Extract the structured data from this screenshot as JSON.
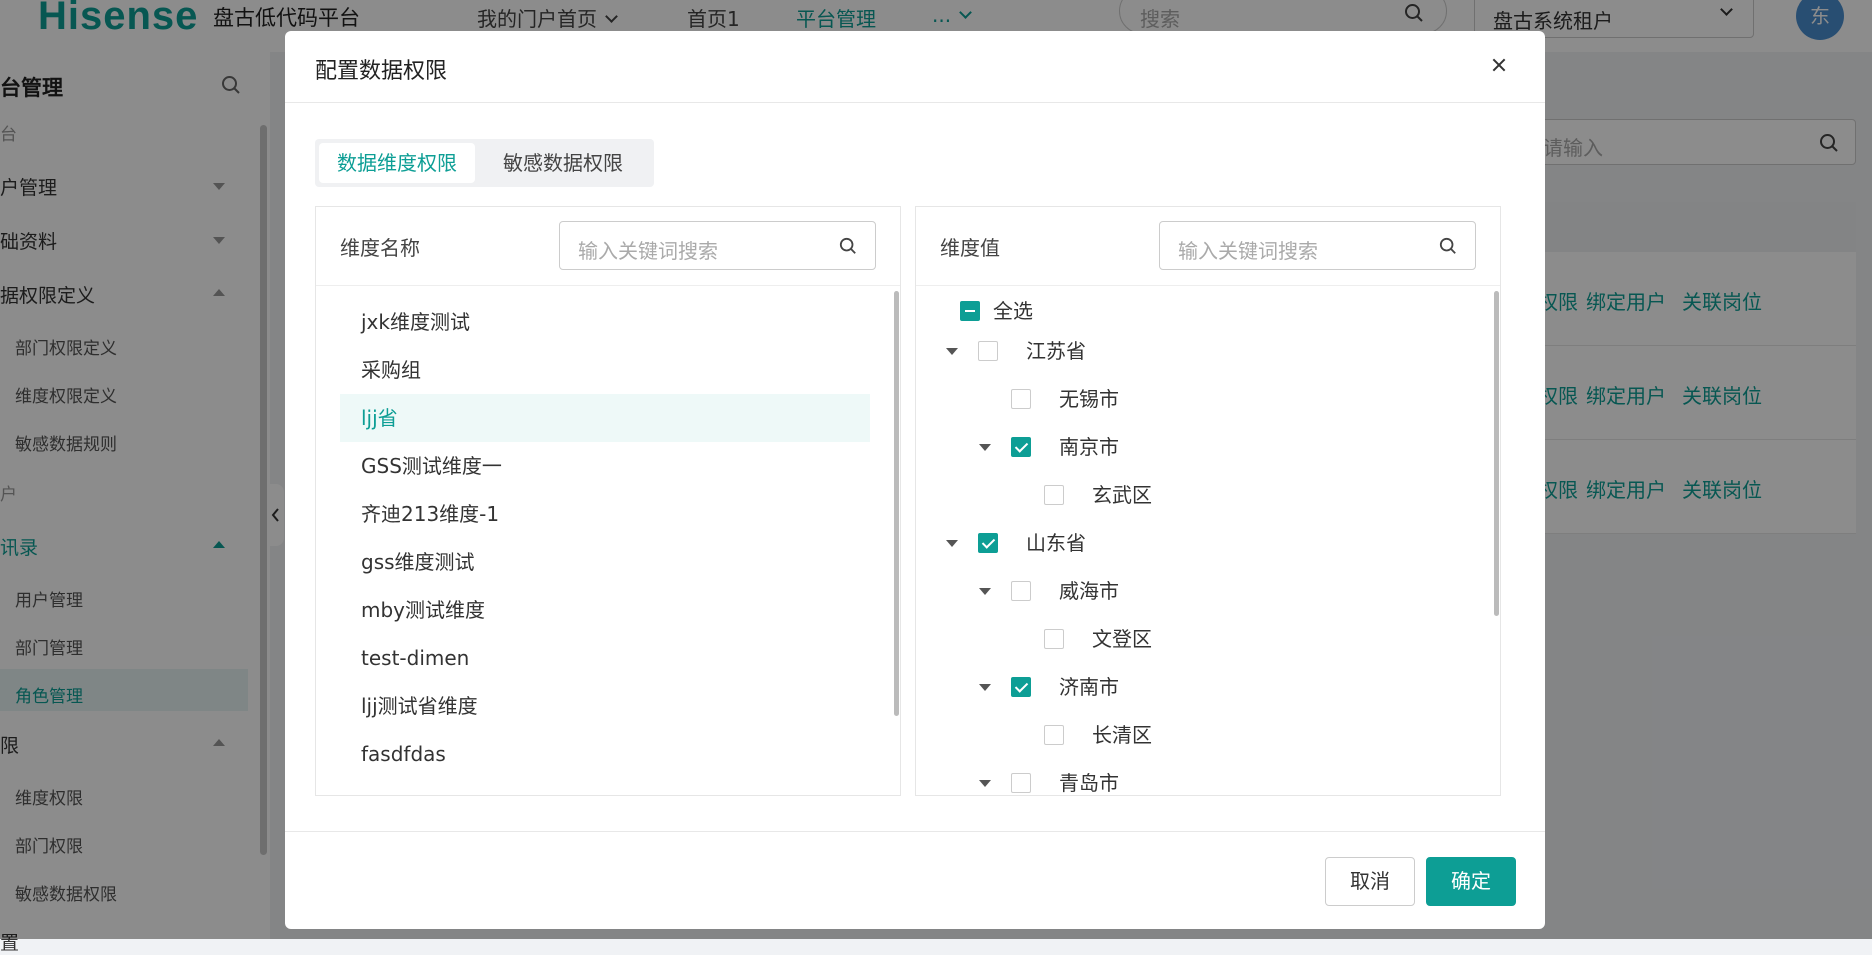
{
  "header": {
    "logo": "Hisense",
    "app_title": "盘古低代码平台",
    "nav": [
      "我的门户首页",
      "首页1",
      "平台管理",
      "..."
    ],
    "search_placeholder": "搜索",
    "tenant": "盘古系统租户",
    "avatar": "东"
  },
  "sidebar": {
    "title": "台管理",
    "items": [
      "台",
      "户管理",
      "础资料",
      "据权限定义",
      "部门权限定义",
      "维度权限定义",
      "敏感数据规则",
      "户",
      "讯录",
      "用户管理",
      "部门管理",
      "角色管理",
      "限",
      "维度权限",
      "部门权限",
      "敏感数据权限",
      "置"
    ]
  },
  "background": {
    "search_placeholder": "请输入",
    "row_actions": [
      "权限",
      "绑定用户",
      "关联岗位"
    ]
  },
  "modal": {
    "title": "配置数据权限",
    "tabs": [
      "数据维度权限",
      "敏感数据权限"
    ],
    "left_panel": {
      "title": "维度名称",
      "search_placeholder": "输入关键词搜索",
      "items": [
        "jxk维度测试",
        "采购组",
        "ljj省",
        "GSS测试维度一",
        "齐迪213维度-1",
        "gss维度测试",
        "mby测试维度",
        "test-dimen",
        "ljj测试省维度",
        "fasdfdas"
      ],
      "selected": "ljj省"
    },
    "right_panel": {
      "title": "维度值",
      "search_placeholder": "输入关键词搜索",
      "select_all": "全选",
      "tree": [
        {
          "label": "江苏省",
          "checked": false
        },
        {
          "label": "无锡市",
          "checked": false
        },
        {
          "label": "南京市",
          "checked": true
        },
        {
          "label": "玄武区",
          "checked": false
        },
        {
          "label": "山东省",
          "checked": true
        },
        {
          "label": "威海市",
          "checked": false
        },
        {
          "label": "文登区",
          "checked": false
        },
        {
          "label": "济南市",
          "checked": true
        },
        {
          "label": "长清区",
          "checked": false
        },
        {
          "label": "青岛市",
          "checked": false
        }
      ]
    },
    "cancel": "取消",
    "confirm": "确定"
  }
}
